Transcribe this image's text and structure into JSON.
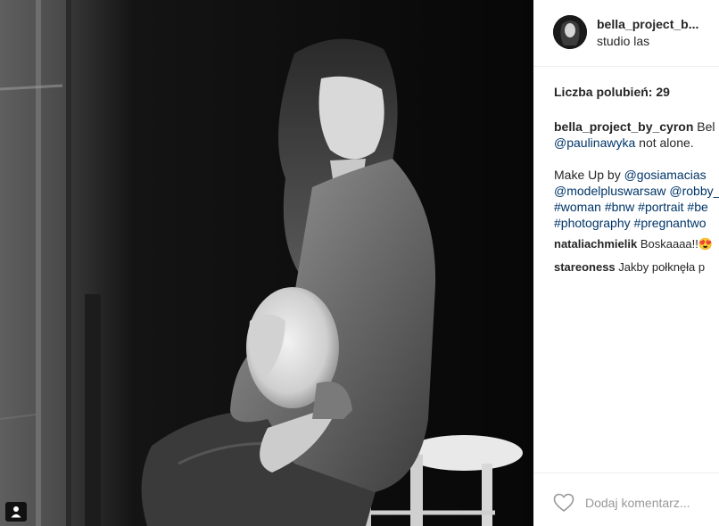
{
  "post": {
    "username": "bella_project_b...",
    "location": "studio las",
    "likes_text": "Liczba polubień: 29"
  },
  "caption": {
    "author": "bella_project_by_cyron",
    "text_start": " Bel",
    "mention_paulina": "@paulinawyka",
    "text_not_alone": " not alone.",
    "makeup_by": "Make Up by ",
    "mention_gosia": "@gosiamacias",
    "mention_modelplus": "@modelpluswarsaw",
    "mention_robby": "@robby_",
    "tag_woman": "#woman",
    "tag_bnw": "#bnw",
    "tag_portrait": "#portrait",
    "tag_be": "#be",
    "tag_photography": "#photography",
    "tag_pregnant": "#pregnantwo"
  },
  "comments": [
    {
      "user": "nataliachmielik",
      "text": " Boskaaaa!!😍"
    },
    {
      "user": "stareoness",
      "text": " Jakby połknęła p"
    }
  ],
  "footer": {
    "comment_placeholder": "Dodaj komentarz..."
  },
  "colors": {
    "link": "#003569",
    "text": "#262626",
    "border": "#efefef",
    "placeholder": "#999999"
  }
}
